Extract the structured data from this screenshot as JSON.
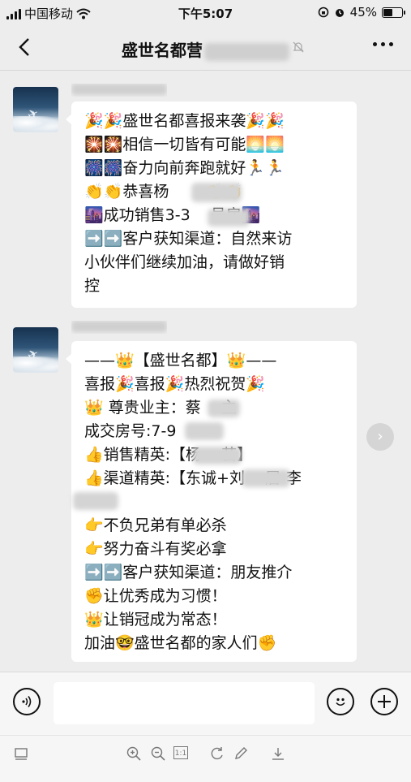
{
  "status": {
    "carrier": "中国移动",
    "time": "下午5:07",
    "battery": "45%",
    "battery_level": 0.45
  },
  "nav": {
    "title": "盛世名都营",
    "mute_icon": "mute-bell-icon",
    "more_icon": "more-dots-icon",
    "back_icon": "back-chevron-icon"
  },
  "messages": [
    {
      "lines": [
        "🎉🎉盛世名都喜报来袭🎉🎉",
        "🎇🎇相信一切皆有可能🌅🌅",
        "🎆🎆奋力向前奔跑就好🏃🏃",
        "  👏👏恭喜杨　　 👏👏",
        " 🌆成功销售3-3　 号房🌆",
        "➡️➡️客户获知渠道：自然来访",
        "小伙伴们继续加油，请做好销",
        "控"
      ]
    },
    {
      "lines": [
        "——👑【盛世名都】👑——",
        "喜报🎉喜报🎉热烈祝贺🎉",
        "👑 尊贵业主：蔡　 主",
        "成交房号:7-9",
        "👍销售精英:【杨　 芸】",
        "👍渠道精英:【东诚+刘　 居-李",
        "　　",
        "👉不负兄弟有单必杀",
        "👉努力奋斗有奖必拿",
        "➡️➡️客户获知渠道：朋友推介",
        "✊让优秀成为习惯！",
        " 👑让销冠成为常态！",
        "加油🤓盛世名都的家人们✊"
      ]
    }
  ],
  "input": {
    "voice_icon": "voice-icon",
    "emoji_icon": "emoji-icon",
    "plus_icon": "plus-icon"
  },
  "toolbar": {
    "icons": [
      "screen-icon",
      "zoom-in-icon",
      "zoom-out-icon",
      "actual-size-icon",
      "rotate-icon",
      "edit-icon",
      "download-icon"
    ],
    "actual_size_label": "1:1"
  }
}
